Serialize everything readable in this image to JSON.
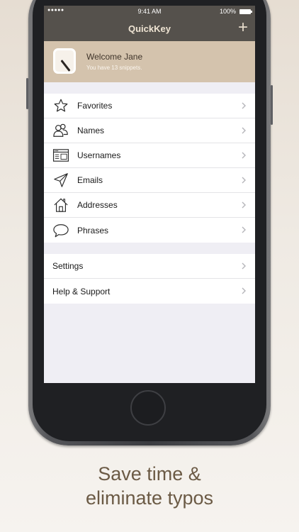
{
  "status_bar": {
    "signal": "●●●●● ",
    "time": "9:41 AM",
    "battery": "100%"
  },
  "nav": {
    "title": "QuickKey",
    "add_label": "+"
  },
  "welcome": {
    "title": "Welcome Jane",
    "subtitle": "You have 13 snippets."
  },
  "categories": [
    {
      "label": "Favorites",
      "icon": "star-icon"
    },
    {
      "label": "Names",
      "icon": "people-icon"
    },
    {
      "label": "Usernames",
      "icon": "browser-window-icon"
    },
    {
      "label": "Emails",
      "icon": "paper-plane-icon"
    },
    {
      "label": "Addresses",
      "icon": "house-icon"
    },
    {
      "label": "Phrases",
      "icon": "speech-bubble-icon"
    }
  ],
  "settings_group": [
    {
      "label": "Settings"
    },
    {
      "label": "Help & Support"
    }
  ],
  "tagline": {
    "line1": "Save time &",
    "line2": "eliminate typos"
  },
  "colors": {
    "nav_bar": "#55514c",
    "welcome_bg": "#d4c3ad",
    "tagline": "#6b5a45"
  }
}
